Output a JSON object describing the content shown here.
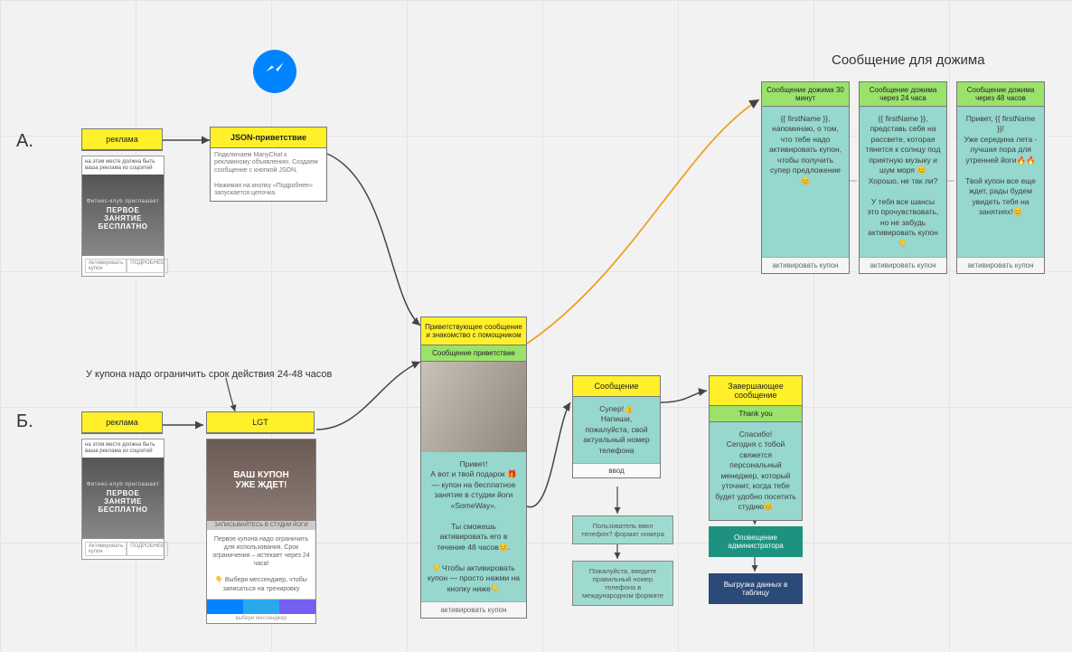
{
  "labels": {
    "A": "А.",
    "B": "Б."
  },
  "titles": {
    "followup": "Сообщение для дожима",
    "couponNote": "У купона надо ограничить срок действия 24-48 часов"
  },
  "nodes": {
    "adA": {
      "header": "реклама",
      "cap": "на этом месте должна быть ваша реклама из соцсетей",
      "heroSmall": "Фитнес-клуб приглашает",
      "hero1": "ПЕРВОЕ",
      "hero2": "ЗАНЯТИЕ",
      "hero3": "БЕСПЛАТНО",
      "btn1": "Активировать купон",
      "btn2": "ПОДРОБНЕЕ"
    },
    "json": {
      "header": "JSON-приветствие",
      "body": "Подключаем ManyChat к рекламному объявлению. Создаем сообщение с кнопкой JSON.\n\nНажимая на кнопку «Подробнее» запускается цепочка."
    },
    "adB": {
      "header": "реклама",
      "cap": "на этом месте должна быть ваша реклама из соцсетей",
      "heroSmall": "Фитнес-клуб приглашает",
      "hero1": "ПЕРВОЕ",
      "hero2": "ЗАНЯТИЕ",
      "hero3": "БЕСПЛАТНО",
      "btn1": "Активировать купон",
      "btn2": "ПОДРОБНЕЕ"
    },
    "lgt": {
      "header": "LGT",
      "hero1": "ВАШ КУПОН",
      "hero2": "УЖЕ ЖДЕТ!",
      "bar": "ЗАПИСЫВАЙТЕСЬ В СТУДИИ ЙОГИ",
      "txt": "Первое купона надо ограничить для использования. Срок ограничения – истекает через 24 часа!\n\n👇 Выбери мессенджер, чтобы записаться на тренировку",
      "sub": "выбери мессенджер"
    },
    "welcome": {
      "header": "Приветствующее сообщение и знакомство с помощником",
      "sub": "Сообщение приветствие",
      "body": "Привет!\nА вот и твой подарок 🎁 — купон на бесплатное занятие в студии йоги «SomeWay».\n\nТы сможешь активировать его в течение 48 часов😊.\n\n👇Чтобы активировать купон — просто нажми на кнопку ниже👇",
      "foot": "активировать купон"
    },
    "phone": {
      "header": "Сообщение",
      "body": "Супер!👍\nНапиши, пожалуйста, свой актуальный номер телефона",
      "chip": "ввод"
    },
    "phoneCheck": "Пользователь ввел телефон? формат номера",
    "phoneRetry": "Пожалуйста, введите правильный номер телефона в международном формате",
    "final": {
      "header": "Завершающее сообщение",
      "sub": "Thank you",
      "body": "Спасибо!\nСегодня с тобой свяжется персональный менеджер, который уточнит, когда тебе будет удобно посетить студию😊"
    },
    "notify": "Оповещение администратора",
    "export": "Выгрузка данных в таблицу",
    "f1": {
      "header": "Сообщение дожима 30 минут",
      "body": "{{ firstName }}, напоминаю, о том, что тебе надо активировать купон, чтобы получить супер предложение 😊",
      "foot": "активировать купон"
    },
    "f2": {
      "header": "Сообщение дожима через 24 часа",
      "body": "{{ firstName }}, представь себя на рассвете, которая тянется к солнцу под приятную музыку и шум моря 😊\nХорошо, не так ли?\n\nУ тебя все шансы это прочувствовать, но не забудь активировать купон👇",
      "foot": "активировать купон"
    },
    "f3": {
      "header": "Сообщение дожима через 48 часов",
      "body": "Привет, {{ firstName }}!\nУже середина лета - лучшая пора для утренней йоги🔥🔥\n\nТвой купон все еще ждет, рады будем увидеть тебя на занятиях!😊",
      "foot": "активировать купон"
    }
  }
}
